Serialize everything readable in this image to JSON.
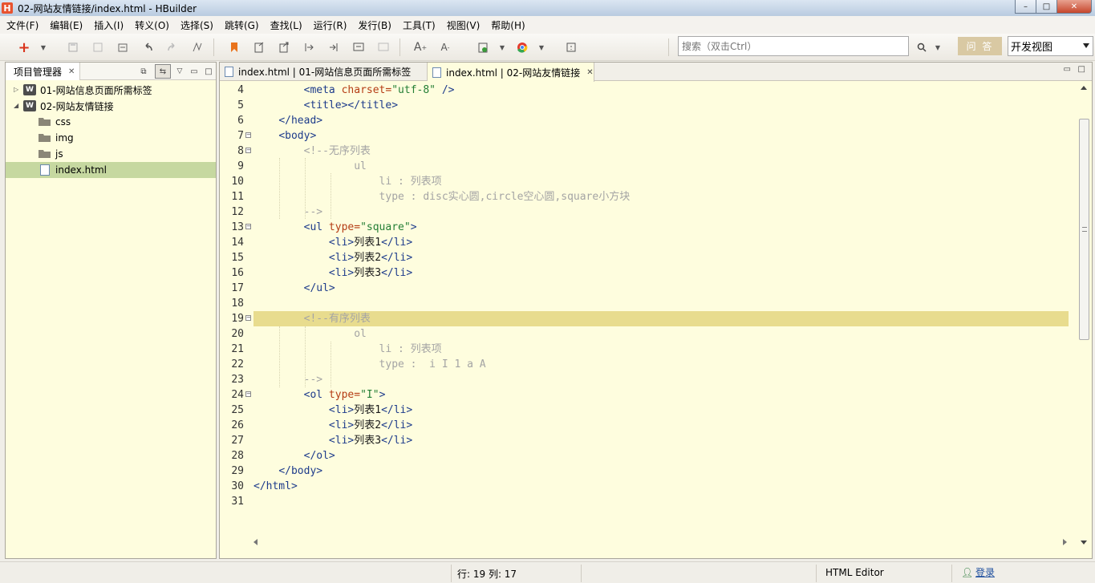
{
  "window": {
    "title": "02-网站友情链接/index.html  -  HBuilder",
    "logo_letter": "H"
  },
  "menubar": {
    "items": [
      "文件(F)",
      "编辑(E)",
      "插入(I)",
      "转义(O)",
      "选择(S)",
      "跳转(G)",
      "查找(L)",
      "运行(R)",
      "发行(B)",
      "工具(T)",
      "视图(V)",
      "帮助(H)"
    ]
  },
  "toolbar": {
    "search_placeholder": "搜索（双击Ctrl）",
    "ask_label": "问 答",
    "view_mode": "开发视图"
  },
  "project_manager": {
    "tab_label": "项目管理器",
    "tree": [
      {
        "label": "01-网站信息页面所需标签",
        "kind": "project",
        "expanded": false
      },
      {
        "label": "02-网站友情链接",
        "kind": "project",
        "expanded": true
      },
      {
        "label": "css",
        "kind": "folder"
      },
      {
        "label": "img",
        "kind": "folder"
      },
      {
        "label": "js",
        "kind": "folder"
      },
      {
        "label": "index.html",
        "kind": "file",
        "selected": true
      }
    ]
  },
  "editor": {
    "tabs": [
      {
        "label": "index.html | 01-网站信息页面所需标签",
        "active": false
      },
      {
        "label": "index.html | 02-网站友情链接",
        "active": true
      }
    ],
    "line_numbers": [
      "4",
      "5",
      "6",
      "7",
      "8",
      "9",
      "10",
      "11",
      "12",
      "13",
      "14",
      "15",
      "16",
      "17",
      "18",
      "19",
      "20",
      "21",
      "22",
      "23",
      "24",
      "25",
      "26",
      "27",
      "28",
      "29",
      "30",
      "31"
    ],
    "highlighted_line": "19",
    "code": {
      "l4_tag": "<meta",
      "l4_attr": " charset=",
      "l4_str": "\"utf-8\"",
      "l4_end": " />",
      "l5_tag": "<title></title>",
      "l6_tag": "</head>",
      "l7_tag": "<body>",
      "l8": "<!--无序列表",
      "l9": "ul",
      "l10": "li : 列表项",
      "l11": "type : disc实心圆,circle空心圆,square小方块",
      "l12": "-->",
      "l13_tag": "<ul",
      "l13_attr": " type=",
      "l13_str": "\"square\"",
      "l13_end": ">",
      "li_open": "<li>",
      "li_close": "</li>",
      "item1": "列表1",
      "item2": "列表2",
      "item3": "列表3",
      "l17_tag": "</ul>",
      "l19": "<!--有序列表",
      "l20": "ol",
      "l21": "li : 列表项",
      "l22": "type :  i I 1 a A",
      "l23": "-->",
      "l24_tag": "<ol",
      "l24_attr": " type=",
      "l24_str": "\"I\"",
      "l24_end": ">",
      "l28_tag": "</ol>",
      "l29_tag": "</body>",
      "l30_tag": "</html>"
    }
  },
  "statusbar": {
    "position": "行: 19 列: 17",
    "editor_type": "HTML Editor",
    "login": "登录"
  }
}
